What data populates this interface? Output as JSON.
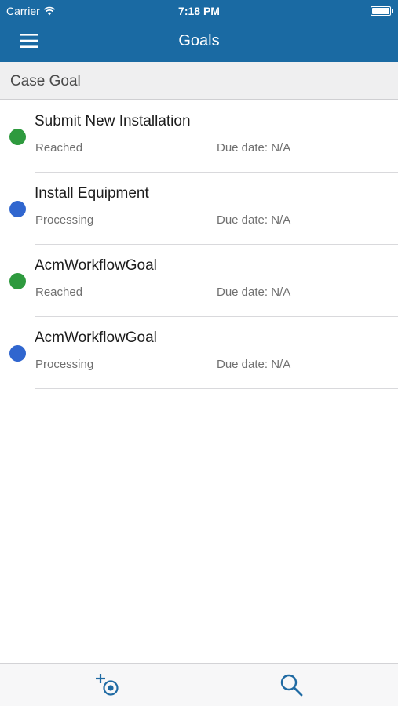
{
  "status_bar": {
    "carrier": "Carrier",
    "time": "7:18 PM"
  },
  "nav": {
    "title": "Goals",
    "menu_icon": "hamburger-menu-icon"
  },
  "section": {
    "title": "Case Goal"
  },
  "goals": [
    {
      "title": "Submit New Installation",
      "status": "Reached",
      "due": "Due date: N/A",
      "status_color": "#2e9a3e"
    },
    {
      "title": "Install Equipment",
      "status": "Processing",
      "due": "Due date: N/A",
      "status_color": "#3066cf"
    },
    {
      "title": "AcmWorkflowGoal",
      "status": "Reached",
      "due": "Due date: N/A",
      "status_color": "#2e9a3e"
    },
    {
      "title": "AcmWorkflowGoal",
      "status": "Processing",
      "due": "Due date: N/A",
      "status_color": "#3066cf"
    }
  ],
  "toolbar": {
    "add_icon": "add-goal-icon",
    "search_icon": "search-icon"
  },
  "colors": {
    "nav_bg": "#1a6aa3",
    "accent": "#1f6aa3",
    "reached": "#2e9a3e",
    "processing": "#3066cf"
  }
}
